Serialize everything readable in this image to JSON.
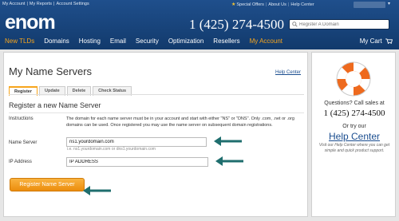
{
  "top_links": {
    "my_account": "My Account",
    "my_reports": "My Reports",
    "account_settings": "Account Settings",
    "special_offers": "Special Offers",
    "about_us": "About Us",
    "help_center": "Help Center"
  },
  "brand": {
    "logo": "enom"
  },
  "header": {
    "phone": "1 (425) 274-4500",
    "search_placeholder": "Register A Domain"
  },
  "nav": {
    "items": [
      "New TLDs",
      "Domains",
      "Hosting",
      "Email",
      "Security",
      "Optimization",
      "Resellers",
      "My Account"
    ],
    "cart": "My Cart",
    "active_color": "#f7a51c"
  },
  "main": {
    "title": "My Name Servers",
    "help_link": "Help Center",
    "tabs": [
      "Register",
      "Update",
      "Delete",
      "Check Status"
    ],
    "section_title": "Register a new Name Server",
    "instructions_label": "Instructions",
    "instructions_text": "The domain for each name server must be in your account and start with either \"NS\" or \"DNS\". Only .com, .net or .org domains can be used. Once registered you may use the name server on subsequent domain registrations.",
    "name_server_label": "Name Server",
    "name_server_value": "ns1.yourdomain.com",
    "name_server_hint": "i.e. ns1.yourdomain.com or dns1.yourdomain.com",
    "ip_label": "IP Address",
    "ip_value": "IP ADDRESS",
    "register_button": "Register Name Server"
  },
  "sidebar": {
    "question": "Questions? Call sales at",
    "phone": "1 (425) 274-4500",
    "try_text": "Or try our",
    "help_center": "Help Center",
    "description": "Visit our Help Center where you can get simple and quick product support."
  },
  "colors": {
    "header_blue": "#1a4a85",
    "accent_orange": "#f7a51c",
    "arrow_teal": "#1f6e6e",
    "link_blue": "#1a4d8f"
  }
}
